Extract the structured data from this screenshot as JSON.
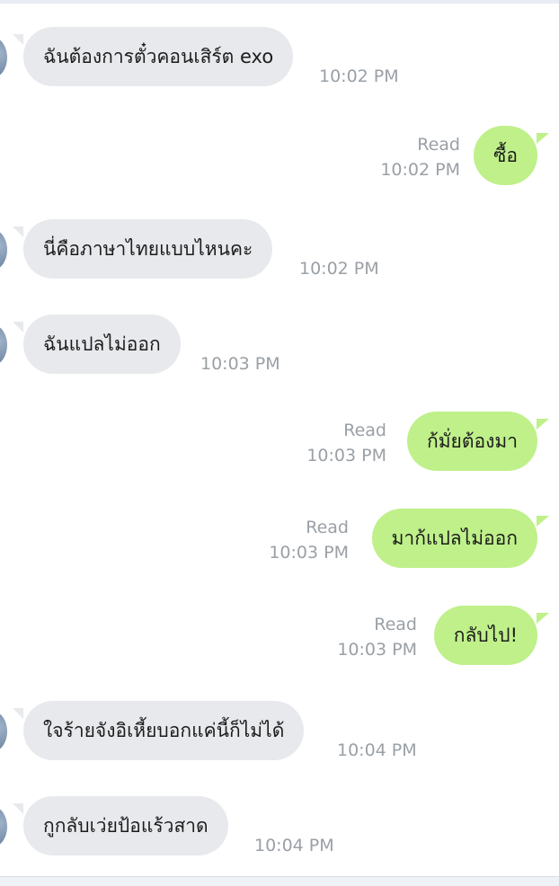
{
  "messages": [
    {
      "direction": "in",
      "text": "ฉันต้องการตั๋วคอนเสิร์ต exo",
      "time": "10:02 PM"
    },
    {
      "direction": "out",
      "text": "ซื้อ",
      "status": "Read",
      "time": "10:02 PM"
    },
    {
      "direction": "in",
      "text": "นี่คือภาษาไทยแบบไหนคะ",
      "time": "10:02 PM"
    },
    {
      "direction": "in",
      "text": "ฉันแปลไม่ออก",
      "time": "10:03 PM"
    },
    {
      "direction": "out",
      "text": "ก้มั่ยต้องมา",
      "status": "Read",
      "time": "10:03 PM"
    },
    {
      "direction": "out",
      "text": "มาก้แปลไม่ออก",
      "status": "Read",
      "time": "10:03 PM"
    },
    {
      "direction": "out",
      "text": "กลับไป!",
      "status": "Read",
      "time": "10:03 PM"
    },
    {
      "direction": "in",
      "text": "ใจร้ายจังอิเหี้ยบอกแค่นี้ก็ไม่ได้",
      "time": "10:04 PM"
    },
    {
      "direction": "in",
      "text": "กูกลับเว่ยป้อแร้วสาด",
      "time": "10:04 PM"
    }
  ],
  "colors": {
    "incoming_bubble": "#e7e9ec",
    "outgoing_bubble": "#bff08a",
    "meta_text": "#9aa0a6"
  }
}
